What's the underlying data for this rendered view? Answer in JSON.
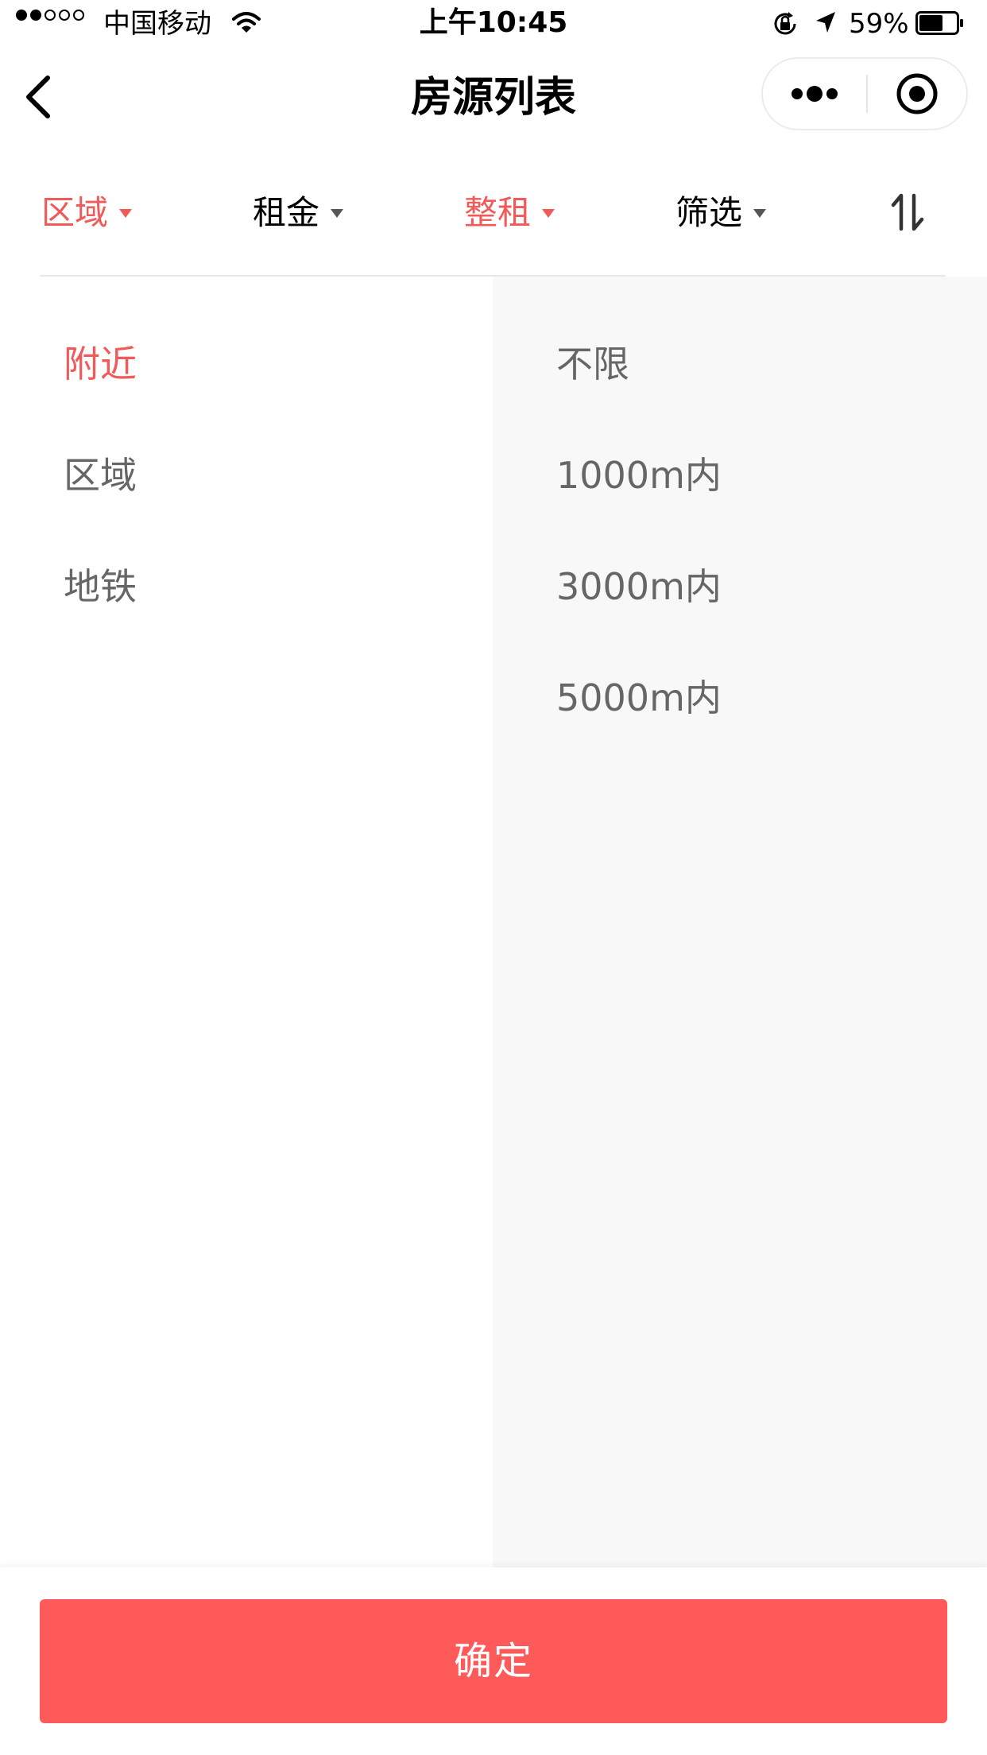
{
  "status_bar": {
    "carrier": "中国移动",
    "time": "上午10:45",
    "battery_percent": "59%",
    "battery_level": 0.59,
    "signal_bars_filled": 2,
    "signal_bars_total": 5
  },
  "nav": {
    "title": "房源列表",
    "back_icon": "chevron-left-icon",
    "more_icon": "more-dots-icon",
    "close_icon": "target-circle-icon"
  },
  "filters": {
    "tabs": [
      {
        "label": "区域",
        "active": true
      },
      {
        "label": "租金",
        "active": false
      },
      {
        "label": "整租",
        "active": true
      },
      {
        "label": "筛选",
        "active": false
      }
    ],
    "sort_icon": "sort-arrows-icon"
  },
  "dropdown": {
    "categories": [
      {
        "label": "附近",
        "active": true
      },
      {
        "label": "区域",
        "active": false
      },
      {
        "label": "地铁",
        "active": false
      }
    ],
    "options": [
      {
        "label": "不限"
      },
      {
        "label": "1000m内"
      },
      {
        "label": "3000m内"
      },
      {
        "label": "5000m内"
      }
    ]
  },
  "footer": {
    "confirm_label": "确定"
  },
  "colors": {
    "accent": "#f25a5a",
    "button_bg": "#ff5a5a",
    "right_panel_bg": "#f8f8f8",
    "text_gray": "#666666"
  }
}
